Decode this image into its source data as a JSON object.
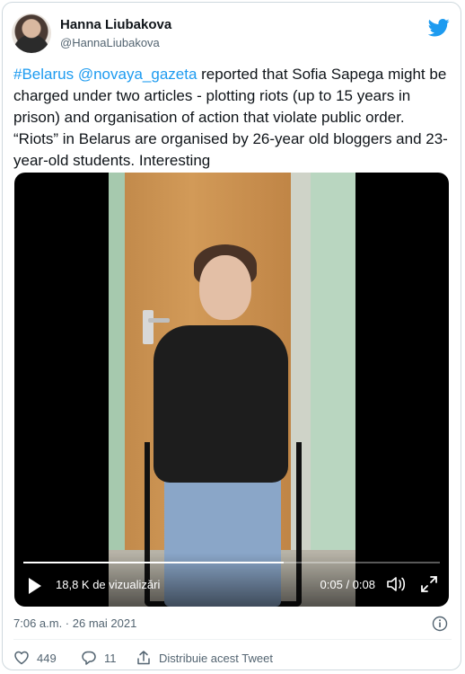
{
  "user": {
    "name": "Hanna Liubakova",
    "handle": "@HannaLiubakova"
  },
  "tweet": {
    "segments": [
      {
        "text": "#Belarus",
        "link": true
      },
      {
        "text": " ",
        "link": false
      },
      {
        "text": "@novaya_gazeta",
        "link": true
      },
      {
        "text": " reported that Sofia Sapega might be charged under two articles - plotting riots (up to 15 years in prison) and organisation of action that violate public order. “Riots” in Belarus are organised by 26-year old bloggers and 23-year-old students. Interesting",
        "link": false
      }
    ]
  },
  "video": {
    "views": "18,8 K de vizualizări",
    "time": "0:05 / 0:08",
    "progress": 0.625
  },
  "meta": {
    "timestamp": "7:06 a.m. · 26 mai 2021"
  },
  "actions": {
    "likes": "449",
    "replies": "11",
    "share_label": "Distribuie acest Tweet"
  },
  "colors": {
    "accent": "#1d9bf0",
    "secondary_text": "#536471"
  },
  "icons": [
    "twitter-bird-icon",
    "play-icon",
    "volume-icon",
    "fullscreen-icon",
    "info-icon",
    "heart-icon",
    "reply-icon",
    "share-icon"
  ]
}
